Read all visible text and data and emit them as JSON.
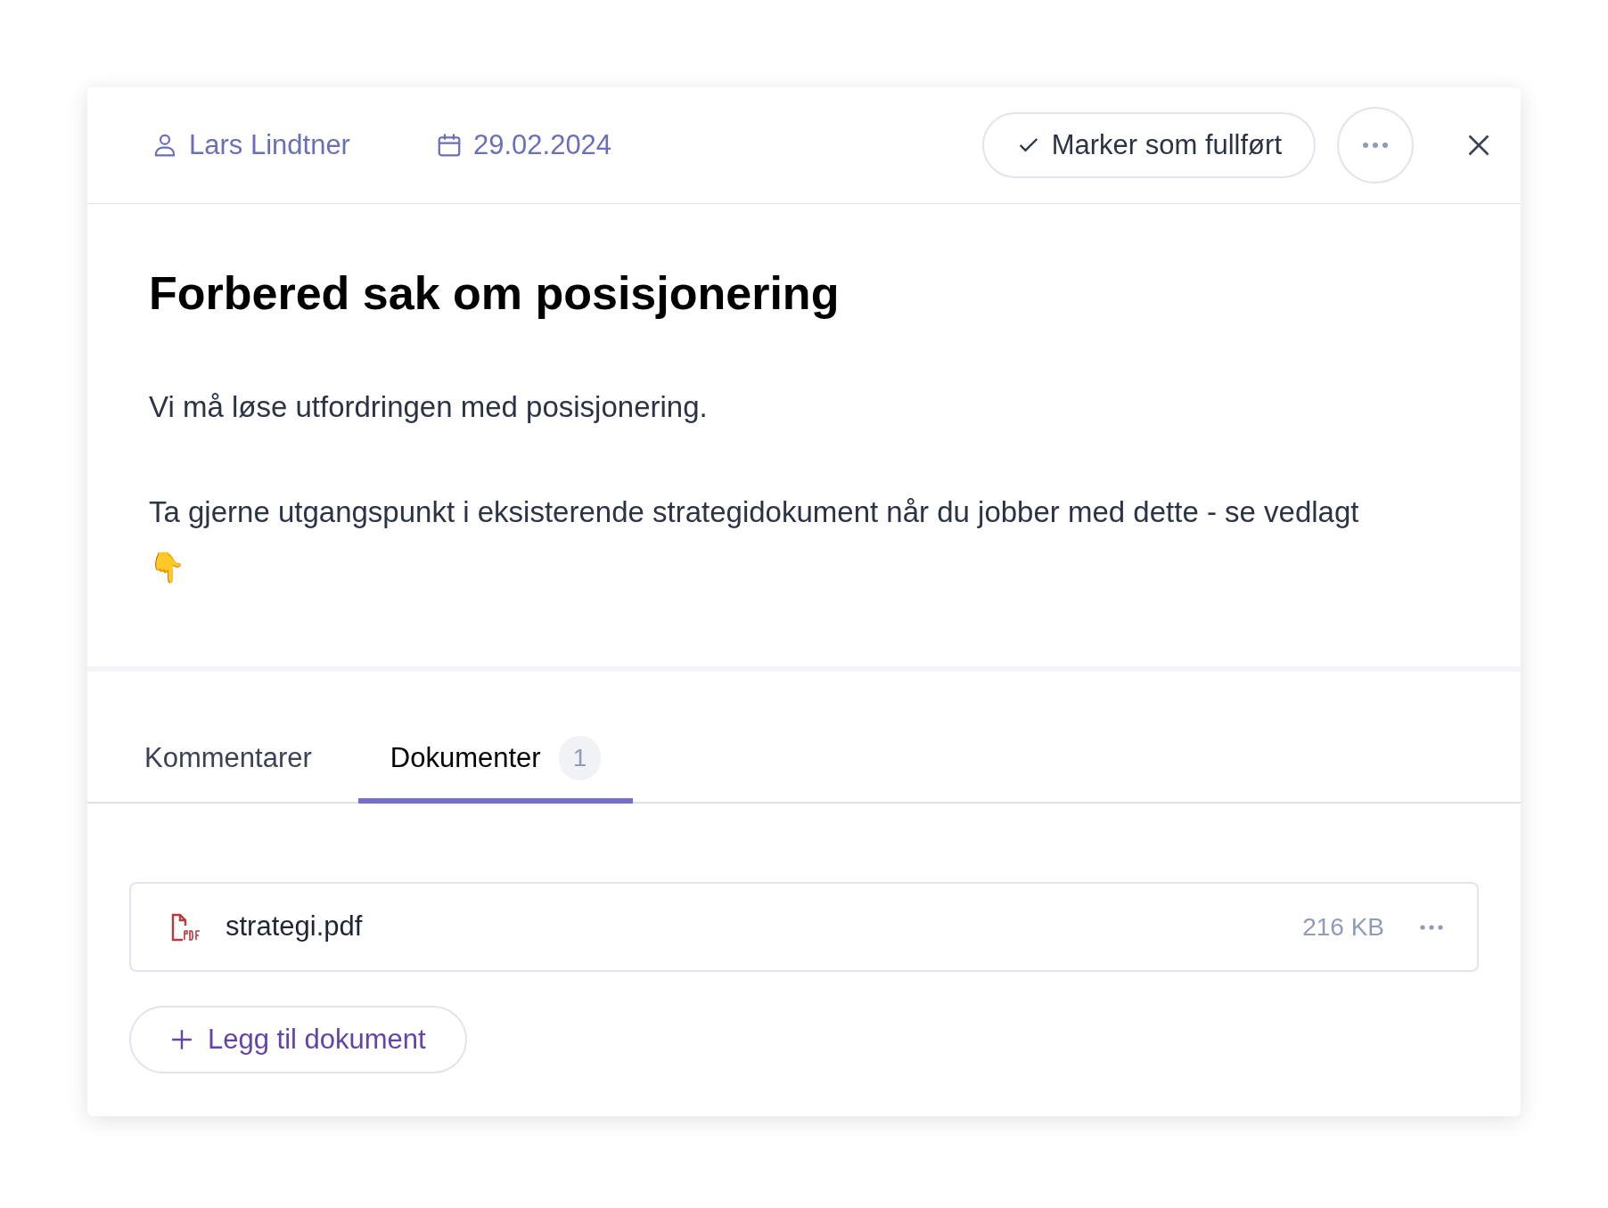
{
  "header": {
    "assignee": "Lars Lindtner",
    "due_date": "29.02.2024",
    "complete_button": "Marker som fullført"
  },
  "task": {
    "title": "Forbered sak om posisjonering",
    "paragraphs": [
      "Vi må løse utfordringen med posisjonering.",
      "Ta gjerne utgangspunkt i eksisterende strategidokument når du jobber med dette - se vedlagt 👇"
    ]
  },
  "tabs": [
    {
      "label": "Kommentarer",
      "selected": false
    },
    {
      "label": "Dokumenter",
      "count": "1",
      "selected": true
    }
  ],
  "documents": [
    {
      "name": "strategi.pdf",
      "size": "216 KB"
    }
  ],
  "add_button": "Legg til dokument"
}
